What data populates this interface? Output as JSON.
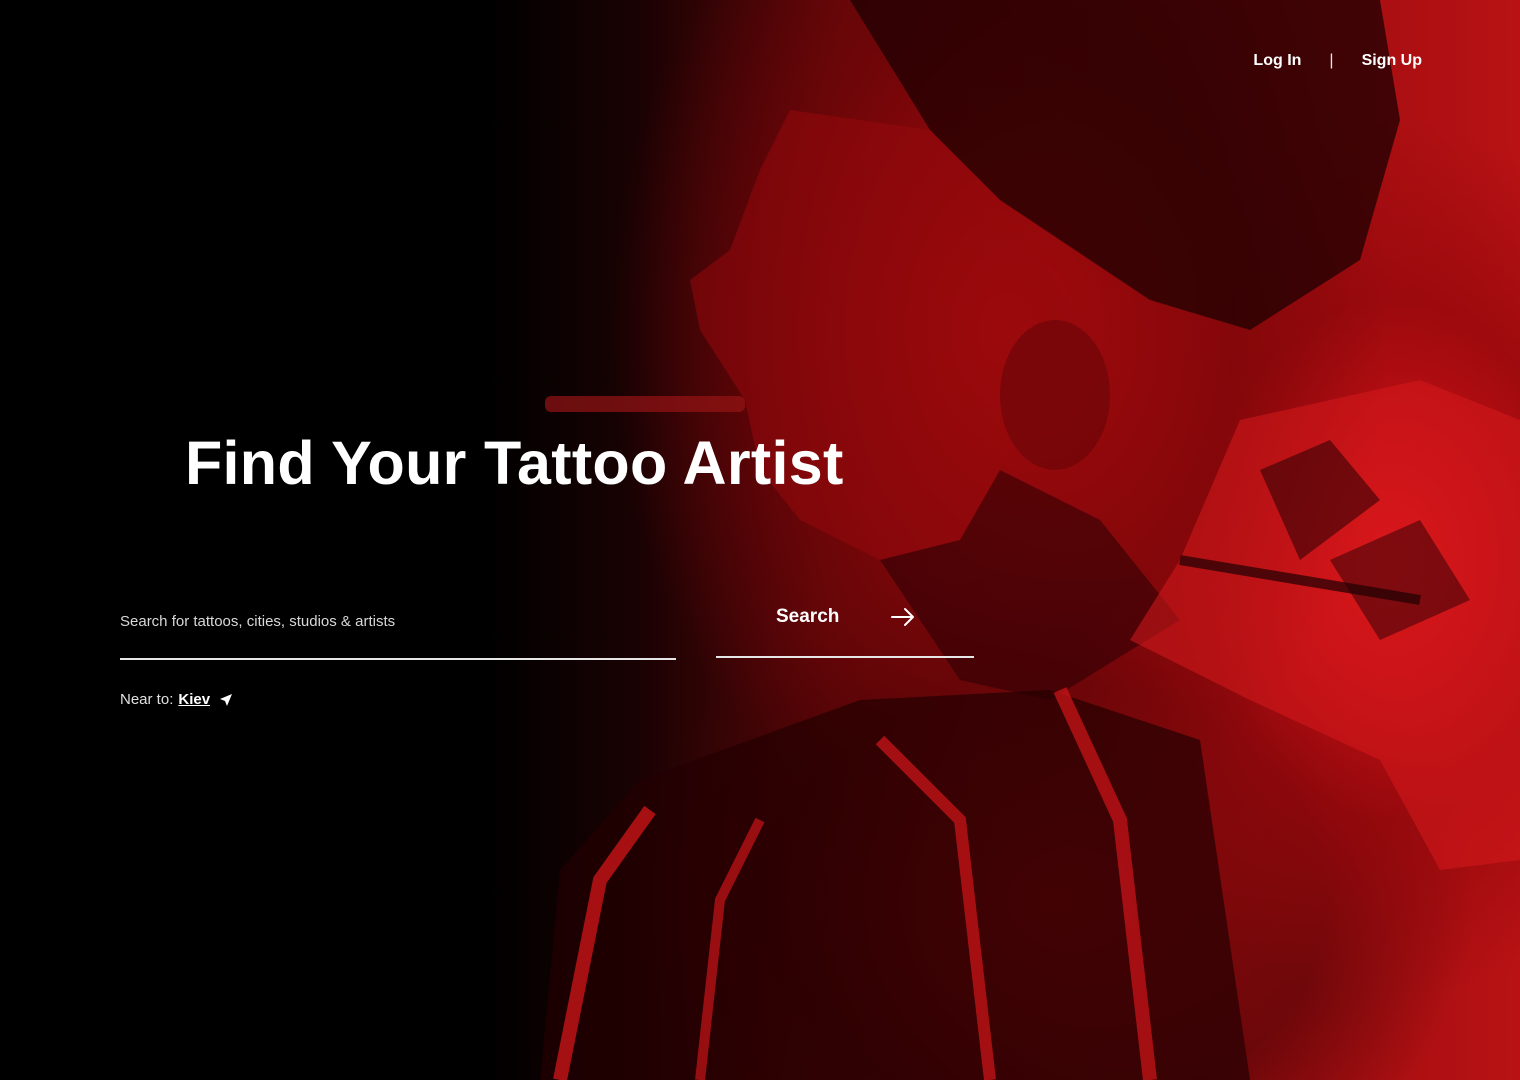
{
  "header": {
    "login_label": "Log In",
    "separator": "|",
    "signup_label": "Sign Up"
  },
  "hero": {
    "title": "Find Your Tattoo Artist"
  },
  "search": {
    "placeholder": "Search for tattoos, cities, studios & artists",
    "value": "",
    "button_label": "Search",
    "button_icon": "arrow-right-icon"
  },
  "location": {
    "prefix": "Near to:",
    "city": "Kiev",
    "icon": "location-arrow-icon"
  },
  "colors": {
    "accent_red": "#b81214",
    "background": "#000000",
    "text": "#ffffff"
  }
}
